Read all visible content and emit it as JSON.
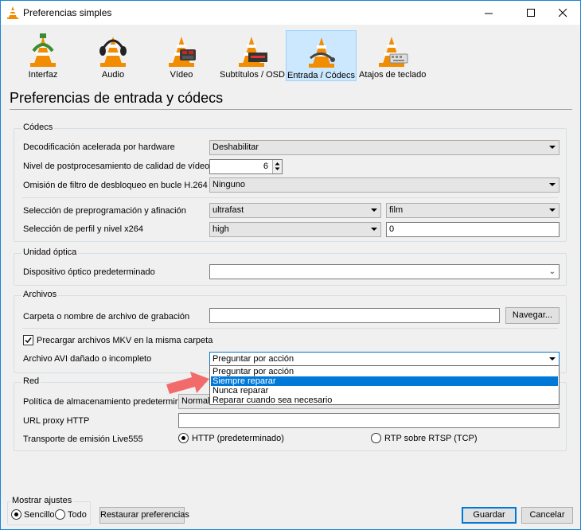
{
  "window": {
    "title": "Preferencias simples"
  },
  "categories": [
    {
      "label": "Interfaz",
      "icon": "interface-cone-icon"
    },
    {
      "label": "Audio",
      "icon": "audio-cone-headphones-icon"
    },
    {
      "label": "Vídeo",
      "icon": "video-cone-icon"
    },
    {
      "label": "Subtítulos / OSD",
      "icon": "subtitles-cone-icon"
    },
    {
      "label": "Entrada / Códecs",
      "icon": "input-codecs-cone-icon",
      "selected": true
    },
    {
      "label": "Atajos de teclado",
      "icon": "hotkeys-cone-icon"
    }
  ],
  "page_title": "Preferencias de entrada y códecs",
  "codecs": {
    "title": "Códecs",
    "hw_label": "Decodificación acelerada por hardware",
    "hw_value": "Deshabilitar",
    "pp_label": "Nivel de postprocesamiento de calidad de vídeo",
    "pp_value": "6",
    "loop_label": "Omisión de filtro de desbloqueo en bucle H.264",
    "loop_value": "Ninguno",
    "preset_label": "Selección de preprogramación y afinación",
    "preset_value": "ultrafast",
    "tune_value": "film",
    "profile_label": "Selección de perfil y nivel x264",
    "profile_value": "high",
    "level_value": "0"
  },
  "optical": {
    "title": "Unidad óptica",
    "device_label": "Dispositivo óptico predeterminado",
    "device_value": ""
  },
  "files": {
    "title": "Archivos",
    "record_label": "Carpeta o nombre de archivo de grabación",
    "record_value": "",
    "browse_label": "Navegar...",
    "mkv_label": "Precargar archivos MKV en la misma carpeta",
    "mkv_checked": true,
    "avi_label": "Archivo AVI dañado o incompleto",
    "avi_value": "Preguntar por acción",
    "avi_options": [
      "Preguntar por acción",
      "Siempre reparar",
      "Nunca reparar",
      "Reparar cuando sea necesario"
    ],
    "avi_highlighted": "Siempre reparar"
  },
  "network": {
    "title": "Red",
    "cache_label": "Política de almacenamiento predeterminada",
    "cache_value": "Normal",
    "proxy_label": "URL proxy HTTP",
    "proxy_value": "",
    "live555_label": "Transporte de emisión Live555",
    "http_label": "HTTP (predeterminado)",
    "rtsp_label": "RTP sobre RTSP (TCP)",
    "transport_selected": "HTTP (predeterminado)"
  },
  "footer": {
    "show_settings_title": "Mostrar ajustes",
    "simple_label": "Sencillo",
    "all_label": "Todo",
    "mode_selected": "Sencillo",
    "reset_label": "Restaurar preferencias",
    "save_label": "Guardar",
    "cancel_label": "Cancelar"
  },
  "colors": {
    "accent": "#0078d7",
    "selected_tab_bg": "#cce8ff",
    "annotation_arrow": "#f26b6b"
  }
}
